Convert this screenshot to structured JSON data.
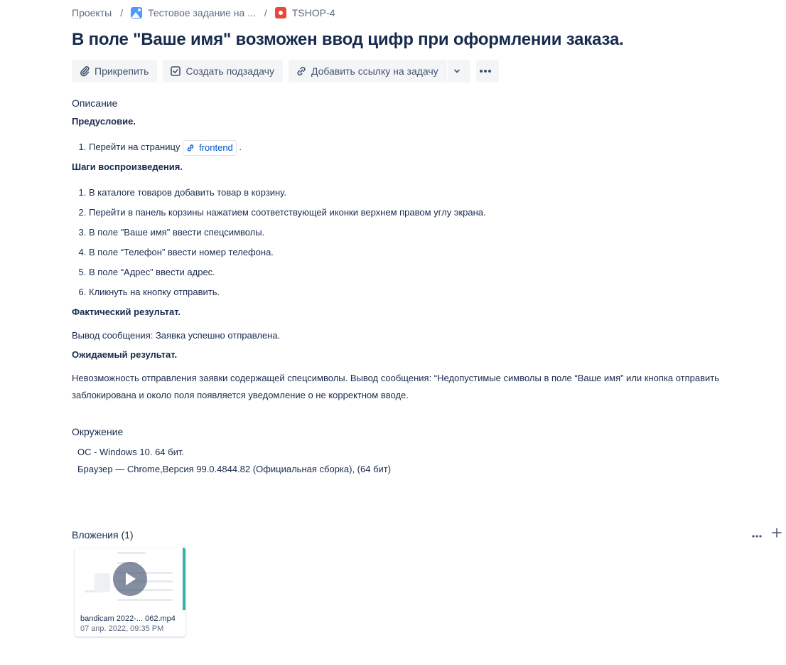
{
  "breadcrumb": {
    "projects": "Проекты",
    "project": "Тестовое задание на ...",
    "issue_key": "TSHOP-4",
    "separator": "/"
  },
  "issue": {
    "title": "В поле \"Ваше имя\" возможен ввод цифр при оформлении заказа."
  },
  "toolbar": {
    "attach_label": "Прикрепить",
    "subtask_label": "Создать подзадачу",
    "link_label": "Добавить ссылку на задачу"
  },
  "description": {
    "label": "Описание",
    "precondition_heading": "Предусловие.",
    "precondition_step_prefix": "Перейти на страницу",
    "precondition_link": "frontend",
    "precondition_step_suffix": ".",
    "steps_heading": "Шаги воспроизведения.",
    "steps": [
      "В каталоге товаров добавить товар в корзину.",
      "Перейти в панель корзины нажатием соответствующей иконки верхнем правом углу экрана.",
      "В поле \"Ваше имя\" ввести спецсимволы.",
      "В поле “Телефон” ввести номер телефона.",
      "В поле “Адрес” ввести адрес.",
      "Кликнуть на кнопку отправить."
    ],
    "actual_heading": "Фактический результат.",
    "actual_text": "Вывод сообщения: Заявка успешно отправлена.",
    "expected_heading": "Ожидаемый результат.",
    "expected_line1": "Невозможность отправления заявки содержащей спецсимволы. Вывод сообщения: “Недопустимые символы в поле “Ваше имя” или кнопка отправить",
    "expected_line2": "заблокирована и около поля появляется уведомление о не корректном вводе."
  },
  "environment": {
    "label": "Окружение",
    "os": "ОС - Windows 10. 64 бит.",
    "browser": "Браузер — Chrome,Версия 99.0.4844.82 (Официальная сборка), (64 бит)"
  },
  "attachments": {
    "label": "Вложения (1)",
    "items": [
      {
        "name": "bandicam 2022-... 062.mp4",
        "date": "07 апр. 2022, 09:35 PM",
        "icon": "play-icon"
      }
    ]
  },
  "colors": {
    "text": "#172b4d",
    "muted": "#5e6c84",
    "link": "#0052cc",
    "button_bg": "#f4f5f7"
  }
}
